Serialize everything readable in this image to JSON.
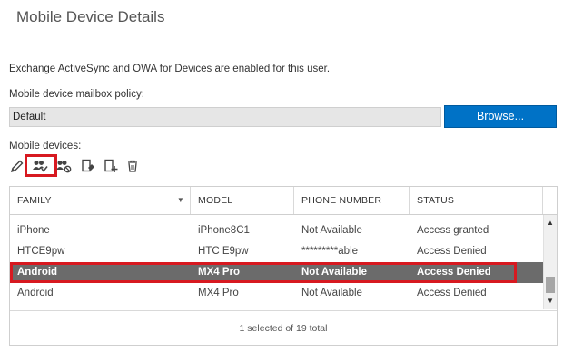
{
  "page": {
    "title": "Mobile Device Details",
    "info_text": "Exchange ActiveSync and OWA for Devices are enabled for this user.",
    "policy_label": "Mobile device mailbox policy:",
    "policy_value": "Default",
    "browse_label": "Browse...",
    "devices_label": "Mobile devices:"
  },
  "toolbar": {
    "icons": [
      "pencil-icon",
      "allow-users-icon",
      "block-users-icon",
      "wipe-device-icon",
      "add-device-icon",
      "delete-icon"
    ],
    "highlighted_icon": "allow-users-icon"
  },
  "table": {
    "columns": [
      "FAMILY",
      "MODEL",
      "PHONE NUMBER",
      "STATUS"
    ],
    "rows": [
      {
        "family": "iPhone",
        "model": "iPhone8C1",
        "phone": "Not Available",
        "status": "Access granted"
      },
      {
        "family": "HTCE9pw",
        "model": "HTC E9pw",
        "phone": "*********able",
        "status": "Access Denied"
      },
      {
        "family": "Android",
        "model": "MX4 Pro",
        "phone": "Not Available",
        "status": "Access Denied"
      },
      {
        "family": "Android",
        "model": "MX4 Pro",
        "phone": "Not Available",
        "status": "Access Denied"
      }
    ],
    "selected_row_index": 2,
    "footer": "1 selected of 19 total"
  },
  "colors": {
    "accent": "#0072c6",
    "selected_row": "#6b6b6b",
    "highlight_outline": "#d71920"
  }
}
